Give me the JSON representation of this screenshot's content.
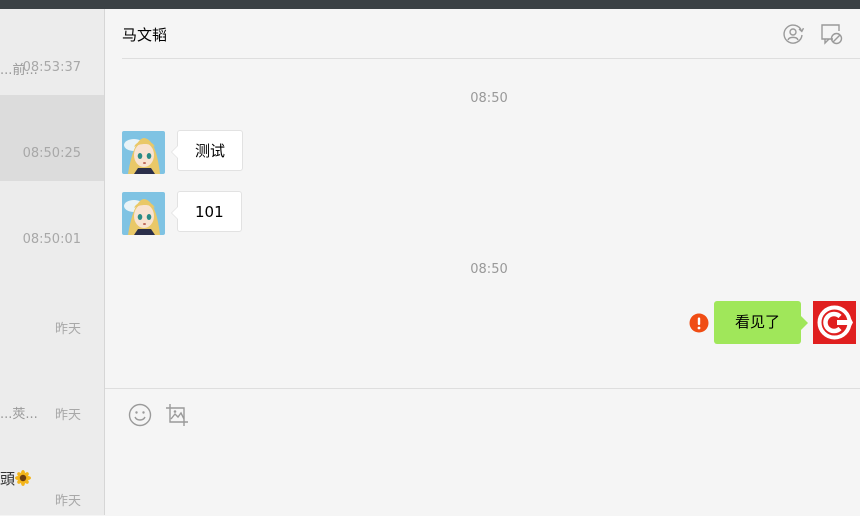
{
  "sessions": [
    {
      "snippet": "...前...",
      "time": "08:53:37"
    },
    {
      "snippet": "",
      "time": "08:50:25",
      "active": true
    },
    {
      "snippet": "",
      "time": "08:50:01"
    },
    {
      "snippet": "",
      "time": "昨天"
    },
    {
      "snippet": "...莢...",
      "time": "昨天"
    },
    {
      "snippet": "頭",
      "time": "昨天"
    }
  ],
  "chat": {
    "title": "马文韬",
    "time_separator_1": "08:50",
    "time_separator_2": "08:50",
    "messages": [
      {
        "side": "left",
        "text": "测试"
      },
      {
        "side": "left",
        "text": "101"
      },
      {
        "side": "right",
        "text": "看见了",
        "status": "failed"
      }
    ]
  },
  "icons": {
    "header": [
      "add-member-icon",
      "close-chat-icon"
    ],
    "toolbar": [
      "emoji-icon",
      "screenshot-icon"
    ],
    "status": "send-failed-icon"
  },
  "colors": {
    "sent_bubble": "#a0e75a",
    "failed": "#f04d14",
    "topbar": "#3b4145"
  }
}
